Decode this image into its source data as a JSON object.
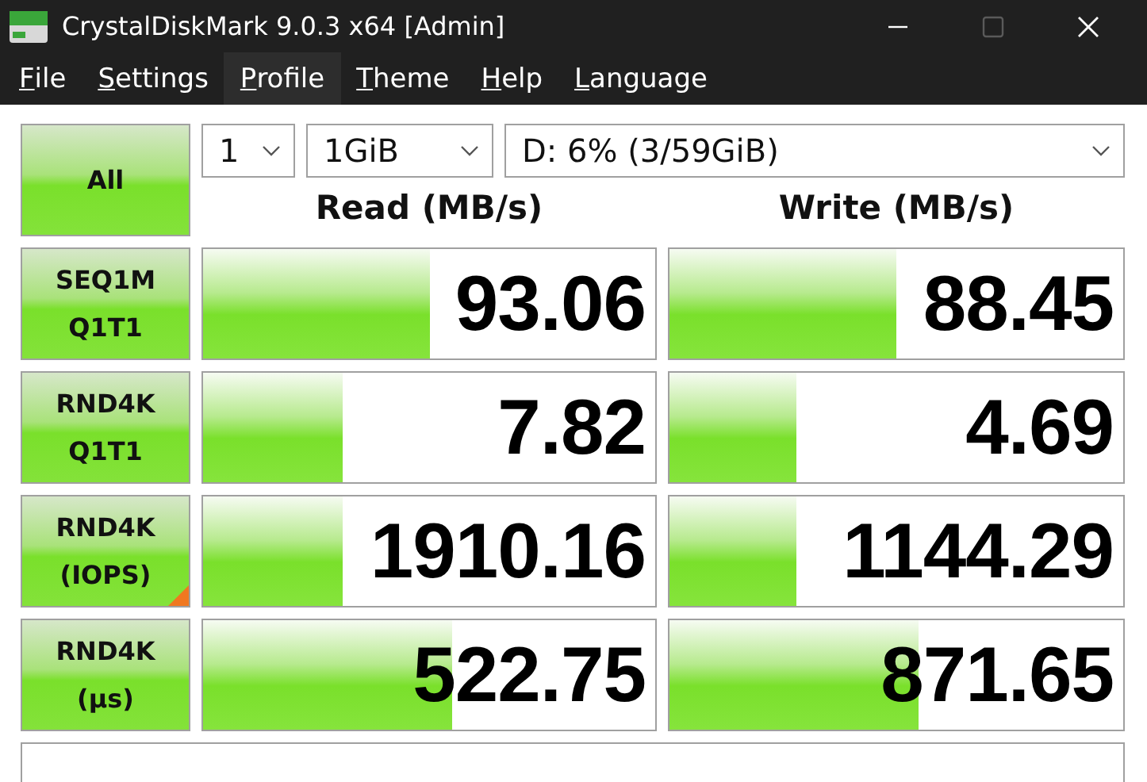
{
  "window": {
    "title": "CrystalDiskMark 9.0.3 x64 [Admin]",
    "maximize_disabled": true
  },
  "menu": [
    {
      "label": "File",
      "highlighted": false
    },
    {
      "label": "Settings",
      "highlighted": false
    },
    {
      "label": "Profile",
      "highlighted": true
    },
    {
      "label": "Theme",
      "highlighted": false
    },
    {
      "label": "Help",
      "highlighted": false
    },
    {
      "label": "Language",
      "highlighted": false
    }
  ],
  "all_button": "All",
  "selectors": {
    "count": "1",
    "size": "1GiB",
    "drive": "D: 6% (3/59GiB)"
  },
  "columns": [
    "Read (MB/s)",
    "Write (MB/s)"
  ],
  "tests": [
    {
      "lines": [
        "SEQ1M",
        "Q1T1"
      ],
      "marked": false,
      "read": {
        "value": "93.06",
        "level": 0.5
      },
      "write": {
        "value": "88.45",
        "level": 0.5
      }
    },
    {
      "lines": [
        "RND4K",
        "Q1T1"
      ],
      "marked": false,
      "read": {
        "value": "7.82",
        "level": 0.31
      },
      "write": {
        "value": "4.69",
        "level": 0.28
      }
    },
    {
      "lines": [
        "RND4K",
        "(IOPS)"
      ],
      "marked": true,
      "read": {
        "value": "1910.16",
        "level": 0.31
      },
      "write": {
        "value": "1144.29",
        "level": 0.28
      }
    },
    {
      "lines": [
        "RND4K",
        "(µs)"
      ],
      "marked": false,
      "read": {
        "value": "522.75",
        "level": 0.55
      },
      "write": {
        "value": "871.65",
        "level": 0.55
      }
    }
  ]
}
